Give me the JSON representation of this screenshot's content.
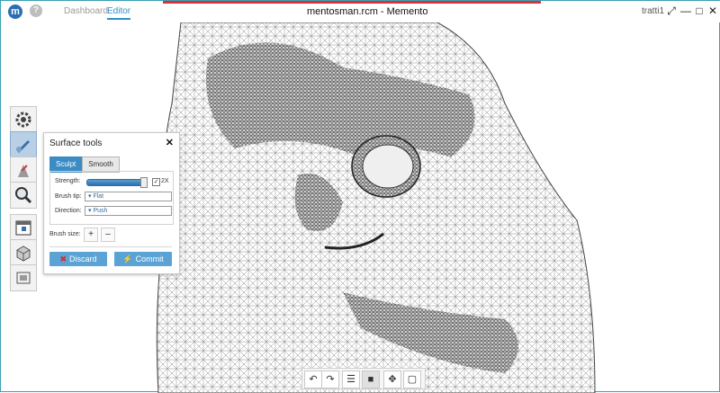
{
  "app": {
    "tabs": [
      {
        "label": "Dashboard",
        "active": false
      },
      {
        "label": "Editor",
        "active": true
      }
    ],
    "window_title": "mentosman.rcm - Memento",
    "user": "tratti1",
    "logo_letter": "m",
    "help_label": "?"
  },
  "window_controls": {
    "fullscreen": "⤢",
    "minimize": "—",
    "maximize": "□",
    "close": "✕"
  },
  "left_toolbar": {
    "items": [
      {
        "name": "settings-gear-icon",
        "active": false
      },
      {
        "name": "sculpt-brush-icon",
        "active": true
      },
      {
        "name": "repair-tool-icon",
        "active": false
      },
      {
        "name": "inspect-magnifier-icon",
        "active": false
      },
      {
        "name": "calendar-tool-icon",
        "active": false
      },
      {
        "name": "export-cube-icon",
        "active": false
      },
      {
        "name": "layers-tool-icon",
        "active": false
      }
    ]
  },
  "surface_panel": {
    "title": "Surface tools",
    "close": "✕",
    "tabs": [
      {
        "label": "Sculpt",
        "active": true
      },
      {
        "label": "Smooth",
        "active": false
      }
    ],
    "strength_label": "Strength:",
    "strength_fraction": 0.95,
    "double_checkbox": {
      "label": "2X",
      "checked": true,
      "mark": "✓"
    },
    "brush_tip_label": "Brush tip:",
    "brush_tip_value": "▾ Flat",
    "direction_label": "Direction:",
    "direction_value": "▾ Push",
    "brush_size_label": "Brush size:",
    "plus": "+",
    "minus": "–",
    "discard_label": "Discard",
    "discard_icon": "✖",
    "commit_label": "Commit",
    "commit_icon": "⚡"
  },
  "bottom_toolbar": {
    "undo": "↶",
    "redo": "↷",
    "list": "☰",
    "cube": "■",
    "move": "✥",
    "select": "▢"
  },
  "colors": {
    "accent": "#2f8fc9",
    "active_tool": "#b9cfe6",
    "button": "#5aa3d4",
    "mesh": "#1a1a1a"
  }
}
